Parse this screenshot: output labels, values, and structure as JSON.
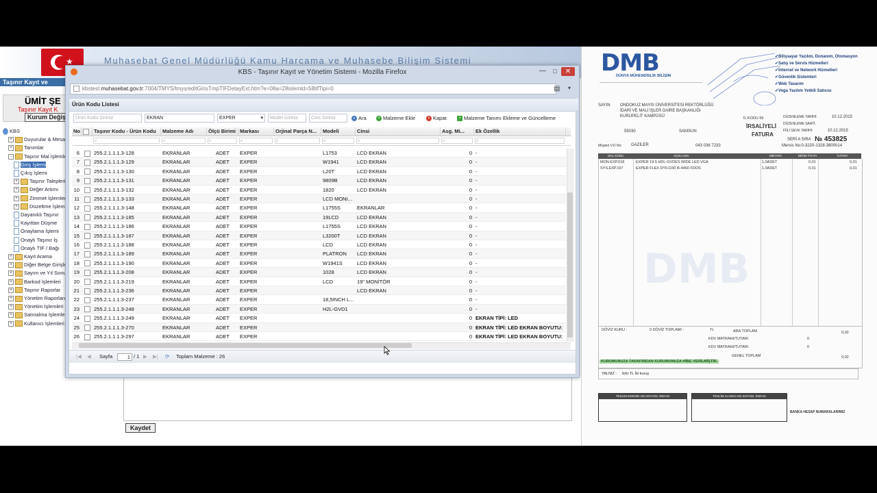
{
  "kbs": {
    "title": "Muhasebat Genel Müdürlüğü Kamu Harcama ve Muhasebe Bilişim Sistemi",
    "strip": "Taşınır Kayıt ve",
    "user_name": "ÜMİT ŞE",
    "user_role": "Taşınır Kayıt K",
    "kurum_button": "Kurum Değişt",
    "save_button": "Kaydet",
    "tree": [
      {
        "label": "KBS",
        "level": 0,
        "type": "root"
      },
      {
        "label": "Duyurular & Mesajla",
        "level": 1,
        "type": "folder",
        "pm": "+"
      },
      {
        "label": "Tanımlar",
        "level": 1,
        "type": "folder",
        "pm": "+"
      },
      {
        "label": "Taşınır Mal İşlemleri",
        "level": 1,
        "type": "folder",
        "pm": "-"
      },
      {
        "label": "Giriş İşlemi",
        "level": 2,
        "type": "doc",
        "selected": true
      },
      {
        "label": "Çıkış İşlemi",
        "level": 2,
        "type": "doc"
      },
      {
        "label": "Taşınır Talepleri",
        "level": 2,
        "type": "folder",
        "pm": "+"
      },
      {
        "label": "Değer Artımı",
        "level": 2,
        "type": "folder",
        "pm": "+"
      },
      {
        "label": "Zimmet İşlemleri",
        "level": 2,
        "type": "folder",
        "pm": "+"
      },
      {
        "label": "Düzeltme İşlemle",
        "level": 2,
        "type": "folder",
        "pm": "+"
      },
      {
        "label": "Dayanıklı Taşınır",
        "level": 2,
        "type": "doc"
      },
      {
        "label": "Kayıttan Düşme",
        "level": 2,
        "type": "doc"
      },
      {
        "label": "Onaylama İşlemi",
        "level": 2,
        "type": "doc"
      },
      {
        "label": "Onaylı Taşınır İş",
        "level": 2,
        "type": "doc"
      },
      {
        "label": "Onaylı TİF / Bağı",
        "level": 2,
        "type": "doc"
      },
      {
        "label": "Kayıt Arama",
        "level": 1,
        "type": "folder",
        "pm": "+"
      },
      {
        "label": "Diğer Belge Girişleri",
        "level": 1,
        "type": "folder",
        "pm": "+"
      },
      {
        "label": "Sayım ve Yıl Sonu İşl",
        "level": 1,
        "type": "folder",
        "pm": "+"
      },
      {
        "label": "Barkod İşlemleri",
        "level": 1,
        "type": "folder",
        "pm": "+"
      },
      {
        "label": "Taşınır Raporlar",
        "level": 1,
        "type": "folder",
        "pm": "+"
      },
      {
        "label": "Yönetim Raporları",
        "level": 1,
        "type": "folder",
        "pm": "+"
      },
      {
        "label": "Yönetim İşlemleri",
        "level": 1,
        "type": "folder",
        "pm": "+"
      },
      {
        "label": "Satınalma İşlemleri",
        "level": 1,
        "type": "folder",
        "pm": "+"
      },
      {
        "label": "Kullanıcı İşlemleri",
        "level": 1,
        "type": "folder",
        "pm": "+"
      }
    ]
  },
  "firefox": {
    "title": "KBS - Taşınır Kayıt ve Yönetim Sistemi - Mozilla Firefox",
    "url_prefix": "kbstest.",
    "url_host": "muhasebat.gov.tr",
    "url_rest": ":7004/TMYS/tmys/editGirisTmpTIFDetayExt.htm?e=08a=28islemld=58tifTipi=0",
    "min": "—",
    "max": "□",
    "close": "✕"
  },
  "list": {
    "title": "Ürün Kodu Listesi",
    "filters": {
      "urun_kodu_placeholder": "Ürün Kodu Giriniz",
      "malzeme_value": "EKRAN",
      "marka_value": "EXPER",
      "model_placeholder": "Model Giriniz",
      "cins_placeholder": "Cins Giriniz"
    },
    "buttons": {
      "ara": "Ara",
      "malzeme_ekle": "Malzeme Ekle",
      "kapat": "Kapat",
      "tanim": "Malzeme Tanımı Ekleme ve Güncelleme"
    },
    "columns": [
      "No",
      "",
      "Taşınır Kodu - Ürün Kodu",
      "Malzeme Adı",
      "Ölçü Birimi",
      "Markası",
      "Orjinal Parça N...",
      "Modeli",
      "Cinsi",
      "Asg. Mi...",
      "Ek Özellik"
    ],
    "rows": [
      {
        "no": "6",
        "kod": "255.2.1.1.1.3-128",
        "ad": "EKRANLAR",
        "birim": "ADET",
        "marka": "EXPER",
        "parca": "",
        "model": "L1753",
        "cins": "LCD EKRAN",
        "asg": "0",
        "ek": "-"
      },
      {
        "no": "7",
        "kod": "255.2.1.1.1.3-129",
        "ad": "EKRANLAR",
        "birim": "ADET",
        "marka": "EXPER",
        "parca": "",
        "model": "W1941",
        "cins": "LCD EKRAN",
        "asg": "0",
        "ek": "-"
      },
      {
        "no": "8",
        "kod": "255.2.1.1.1.3-130",
        "ad": "EKRANLAR",
        "birim": "ADET",
        "marka": "EXPER",
        "parca": "",
        "model": "L20T",
        "cins": "LCD EKRAN",
        "asg": "0",
        "ek": "-"
      },
      {
        "no": "9",
        "kod": "255.2.1.1.1.3-131",
        "ad": "EKRANLAR",
        "birim": "ADET",
        "marka": "EXPER",
        "parca": "",
        "model": "9809B",
        "cins": "LCD EKRAN",
        "asg": "0",
        "ek": "-"
      },
      {
        "no": "10",
        "kod": "255.2.1.1.1.3-132",
        "ad": "EKRANLAR",
        "birim": "ADET",
        "marka": "EXPER",
        "parca": "",
        "model": "1820",
        "cins": "LCD EKRAN",
        "asg": "0",
        "ek": "-"
      },
      {
        "no": "11",
        "kod": "255.2.1.1.1.3-133",
        "ad": "EKRANLAR",
        "birim": "ADET",
        "marka": "EXPER",
        "parca": "",
        "model": "LCD MONI...",
        "cins": "",
        "asg": "0",
        "ek": "-"
      },
      {
        "no": "12",
        "kod": "255.2.1.1.1.3-148",
        "ad": "EKRANLAR",
        "birim": "ADET",
        "marka": "EXPER",
        "parca": "",
        "model": "L1755S",
        "cins": "EKRANLAR",
        "asg": "0",
        "ek": "-"
      },
      {
        "no": "13",
        "kod": "255.2.1.1.1.3-185",
        "ad": "EKRANLAR",
        "birim": "ADET",
        "marka": "EXPER",
        "parca": "",
        "model": "19LCD",
        "cins": "LCD EKRAN",
        "asg": "0",
        "ek": "-"
      },
      {
        "no": "14",
        "kod": "255.2.1.1.1.3-186",
        "ad": "EKRANLAR",
        "birim": "ADET",
        "marka": "EXPER",
        "parca": "",
        "model": "L1755S",
        "cins": "LCD EKRAN",
        "asg": "0",
        "ek": "-"
      },
      {
        "no": "15",
        "kod": "255.2.1.1.1.3-187",
        "ad": "EKRANLAR",
        "birim": "ADET",
        "marka": "EXPER",
        "parca": "",
        "model": "L3200T",
        "cins": "LCD EKRAN",
        "asg": "0",
        "ek": "-"
      },
      {
        "no": "16",
        "kod": "255.2.1.1.1.3-188",
        "ad": "EKRANLAR",
        "birim": "ADET",
        "marka": "EXPER",
        "parca": "",
        "model": "LCD",
        "cins": "LCD EKRAN",
        "asg": "0",
        "ek": "-"
      },
      {
        "no": "17",
        "kod": "255.2.1.1.1.3-189",
        "ad": "EKRANLAR",
        "birim": "ADET",
        "marka": "EXPER",
        "parca": "",
        "model": "PLATRON",
        "cins": "LCD EKRAN",
        "asg": "0",
        "ek": "-"
      },
      {
        "no": "18",
        "kod": "255.2.1.1.1.3-190",
        "ad": "EKRANLAR",
        "birim": "ADET",
        "marka": "EXPER",
        "parca": "",
        "model": "W1941S",
        "cins": "LCD EKRAN",
        "asg": "0",
        "ek": "-"
      },
      {
        "no": "19",
        "kod": "255.2.1.1.1.3-208",
        "ad": "EKRANLAR",
        "birim": "ADET",
        "marka": "EXPER",
        "parca": "",
        "model": "1028",
        "cins": "LCD EKRAN",
        "asg": "0",
        "ek": "-"
      },
      {
        "no": "20",
        "kod": "255.2.1.1.1.3-219",
        "ad": "EKRANLAR",
        "birim": "ADET",
        "marka": "EXPER",
        "parca": "",
        "model": "LCD",
        "cins": "19\" MONİTÖR",
        "asg": "0",
        "ek": "-"
      },
      {
        "no": "21",
        "kod": "255.2.1.1.1.3-236",
        "ad": "EKRANLAR",
        "birim": "ADET",
        "marka": "EXPER",
        "parca": "",
        "model": "",
        "cins": "LCD EKRAN",
        "asg": "0",
        "ek": "-"
      },
      {
        "no": "22",
        "kod": "255.2.1.1.1.3-237",
        "ad": "EKRANLAR",
        "birim": "ADET",
        "marka": "EXPER",
        "parca": "",
        "model": "18,5INCH L...",
        "cins": "",
        "asg": "0",
        "ek": "-"
      },
      {
        "no": "23",
        "kod": "255.2.1.1.1.3-248",
        "ad": "EKRANLAR",
        "birim": "ADET",
        "marka": "EXPER",
        "parca": "",
        "model": "H2L-GVD1",
        "cins": "",
        "asg": "0",
        "ek": "-"
      },
      {
        "no": "24",
        "kod": "255.2.1.1.1.3-249",
        "ad": "EKRANLAR",
        "birim": "ADET",
        "marka": "EXPER",
        "parca": "",
        "model": "",
        "cins": "",
        "asg": "0",
        "ek": "EKRAN TİPİ: LED"
      },
      {
        "no": "25",
        "kod": "255.2.1.1.1.3-270",
        "ad": "EKRANLAR",
        "birim": "ADET",
        "marka": "EXPER",
        "parca": "",
        "model": "",
        "cins": "",
        "asg": "0",
        "ek": "EKRAN TİPİ: LED    EKRAN BOYUTU:"
      },
      {
        "no": "26",
        "kod": "255.2.1.1.1.3-297",
        "ad": "EKRANLAR",
        "birim": "ADET",
        "marka": "EXPER",
        "parca": "",
        "model": "",
        "cins": "",
        "asg": "0",
        "ek": "EKRAN TİPİ: LED    EKRAN BOYUTU:"
      }
    ],
    "pager": {
      "sayfa": "Sayfa",
      "page": "1",
      "of": "/ 1",
      "total": "Toplam Malzeme : 26"
    }
  },
  "invoice": {
    "logo": "DMB",
    "logo_sub": "DÜNYA MÜHENDİSLİK BİLİŞİM",
    "services": [
      "Bilişsayar Yazılım, Donanım, Otomasyon",
      "Satış ve Servis Hizmetleri",
      "İnternet ve Network Hizmetleri",
      "Güvenlik Sistemleri",
      "Web Tasarım",
      "Vega Yazılım Yetkili Satıcısı"
    ],
    "sayin": "SAYIN",
    "customer_lines": [
      "ONDOKUZ MAYIS ÜNİVERSİTESİ REKTÖRLÜĞÜ",
      "İDARİ VE MALİ İŞLER DAİRE BAŞKANLIĞI",
      "KURUPELİT KAMPÜSÜ"
    ],
    "postcode": "55030",
    "city": "SAMSUN",
    "vd_label": "Müşteri V.D No:",
    "vd": "GAZİLER",
    "vd_no": "043 036 7233",
    "il_kodu": "İL KODU 55",
    "doc_type_1": "İRSALİYELİ",
    "doc_type_2": "FATURA",
    "dates": [
      [
        "DÜZENLEME TARİHİ:",
        "10.12.2015"
      ],
      [
        "DÜZENLEME SAATİ:",
        ""
      ],
      [
        "FİİLİ SEVK TARİHİ:",
        "10.12.2015"
      ]
    ],
    "seri_label": "SERİ A SIRA",
    "seri_no": "№ 453825",
    "mersis": "Mersis No:0-3220-1328-3800014",
    "table_headers": [
      "MAL KODU",
      "AÇIKLAMA",
      "MİKTARI",
      "BİRİM FİYATI",
      "TUTARI"
    ],
    "items": [
      {
        "code": "MON.EXP.018",
        "desc": "EXPER 19.5 HDL-GVDES WIDE LED VGA",
        "qty": "1,0ADET",
        "price": "0,01",
        "total": "0,01"
      },
      {
        "code": "SYS.EXP.197",
        "desc": "EXPER FLEX DY6-D30 i5-4460 FDOS",
        "qty": "1,0ADET",
        "price": "0,01",
        "total": "0,01"
      }
    ],
    "doviz_kuru": "DÖVİZ KURU :",
    "doviz_toplami": "0 DÖVİZ TOPLAMI :",
    "doviz_val": "0",
    "tl": "TL",
    "ara_toplam": "ARA TOPLAM",
    "ara_toplam_val": "0,02",
    "kdv1": "KDV MATRAHI/TUTARI",
    "kdv1_val": "0",
    "kdv2": "KDV MATRAHI/TUTARI",
    "kdv2_val": "0",
    "genel_toplam": "GENEL TOPLAM",
    "genel_toplam_val": "0,02",
    "green_note": "KURUMUNUZA TARAFINDAN KURUMUNUZA HİBE VERİLMİŞTİR.",
    "yalniz": "YALNIZ :",
    "yalniz_val": "Sıfır TL İki kuruş",
    "teslim_eden": "TESLİM EDENİN ADI SOYADI, İMZASI",
    "teslim_alan": "TESLİM ALANIN ADI SOYADI, İMZASI",
    "banka": "BANKA HESAP NUMARALARIMIZ",
    "watermark": "DMB"
  }
}
